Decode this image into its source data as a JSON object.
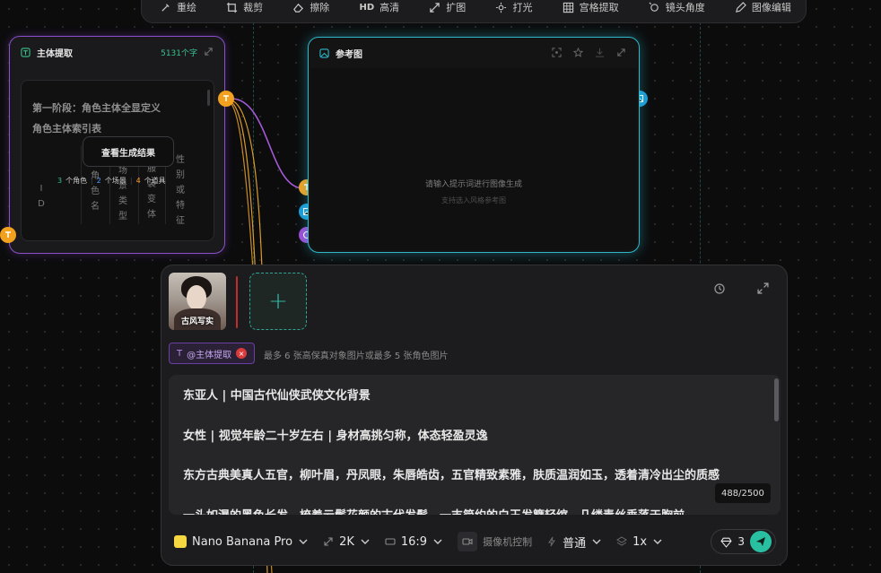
{
  "toolbar": {
    "items": [
      {
        "label": "重绘",
        "icon": "brush-icon"
      },
      {
        "label": "裁剪",
        "icon": "crop-icon"
      },
      {
        "label": "擦除",
        "icon": "eraser-icon"
      },
      {
        "label": "高清",
        "icon": "hd-icon",
        "prefix": "HD"
      },
      {
        "label": "扩图",
        "icon": "expand-image-icon"
      },
      {
        "label": "打光",
        "icon": "light-icon"
      },
      {
        "label": "宫格提取",
        "icon": "grid-icon"
      },
      {
        "label": "镜头角度",
        "icon": "camera-angle-icon"
      },
      {
        "label": "图像编辑",
        "icon": "pen-edit-icon"
      }
    ]
  },
  "subject_node": {
    "title": "主体提取",
    "char_count": "5131个字",
    "line1": "第一阶段：角色主体全显定义",
    "line2": "角色主体索引表",
    "table_cols": [
      "ID",
      "角色名",
      "场景类型",
      "服装变体",
      "性别或特征"
    ],
    "stats": {
      "roles": "3",
      "roles_label": "个角色",
      "scenes": "2",
      "scenes_label": "个场景",
      "props": "4",
      "props_label": "个道具"
    },
    "view_button": "查看生成结果"
  },
  "image_node": {
    "title": "参考图",
    "hint": "请输入提示词进行图像生成",
    "subhint": "支持选入风格参考图"
  },
  "panel": {
    "thumb_caption": "古风写实",
    "tag_label": "@主体提取",
    "tag_hint": "最多 6 张高保真对象图片或最多 5 张角色图片",
    "prompt_lines": [
      "东亚人 | 中国古代仙侠武侠文化背景",
      "女性 | 视觉年龄二十岁左右 | 身材高挑匀称，体态轻盈灵逸",
      "东方古典美真人五官，柳叶眉，丹凤眼，朱唇皓齿，五官精致素雅，肤质温润如玉，透着清冷出尘的质感",
      "一头如瀑的黑色长发，梳着云鬓花颜的古代发髻，一支简约的白玉发簪轻绾，几缕青丝垂落于胸前"
    ],
    "counter": "488/2500",
    "footer": {
      "model": "Nano Banana Pro",
      "resolution": "2K",
      "ratio": "16:9",
      "camera_label": "摄像机控制",
      "mode": "普通",
      "count": "1x",
      "cost": "3"
    }
  },
  "colors": {
    "accent_teal": "#2fb6c9",
    "accent_purple": "#8a4fc9",
    "port_orange": "#f2a11f",
    "send_green": "#29c0a2"
  }
}
